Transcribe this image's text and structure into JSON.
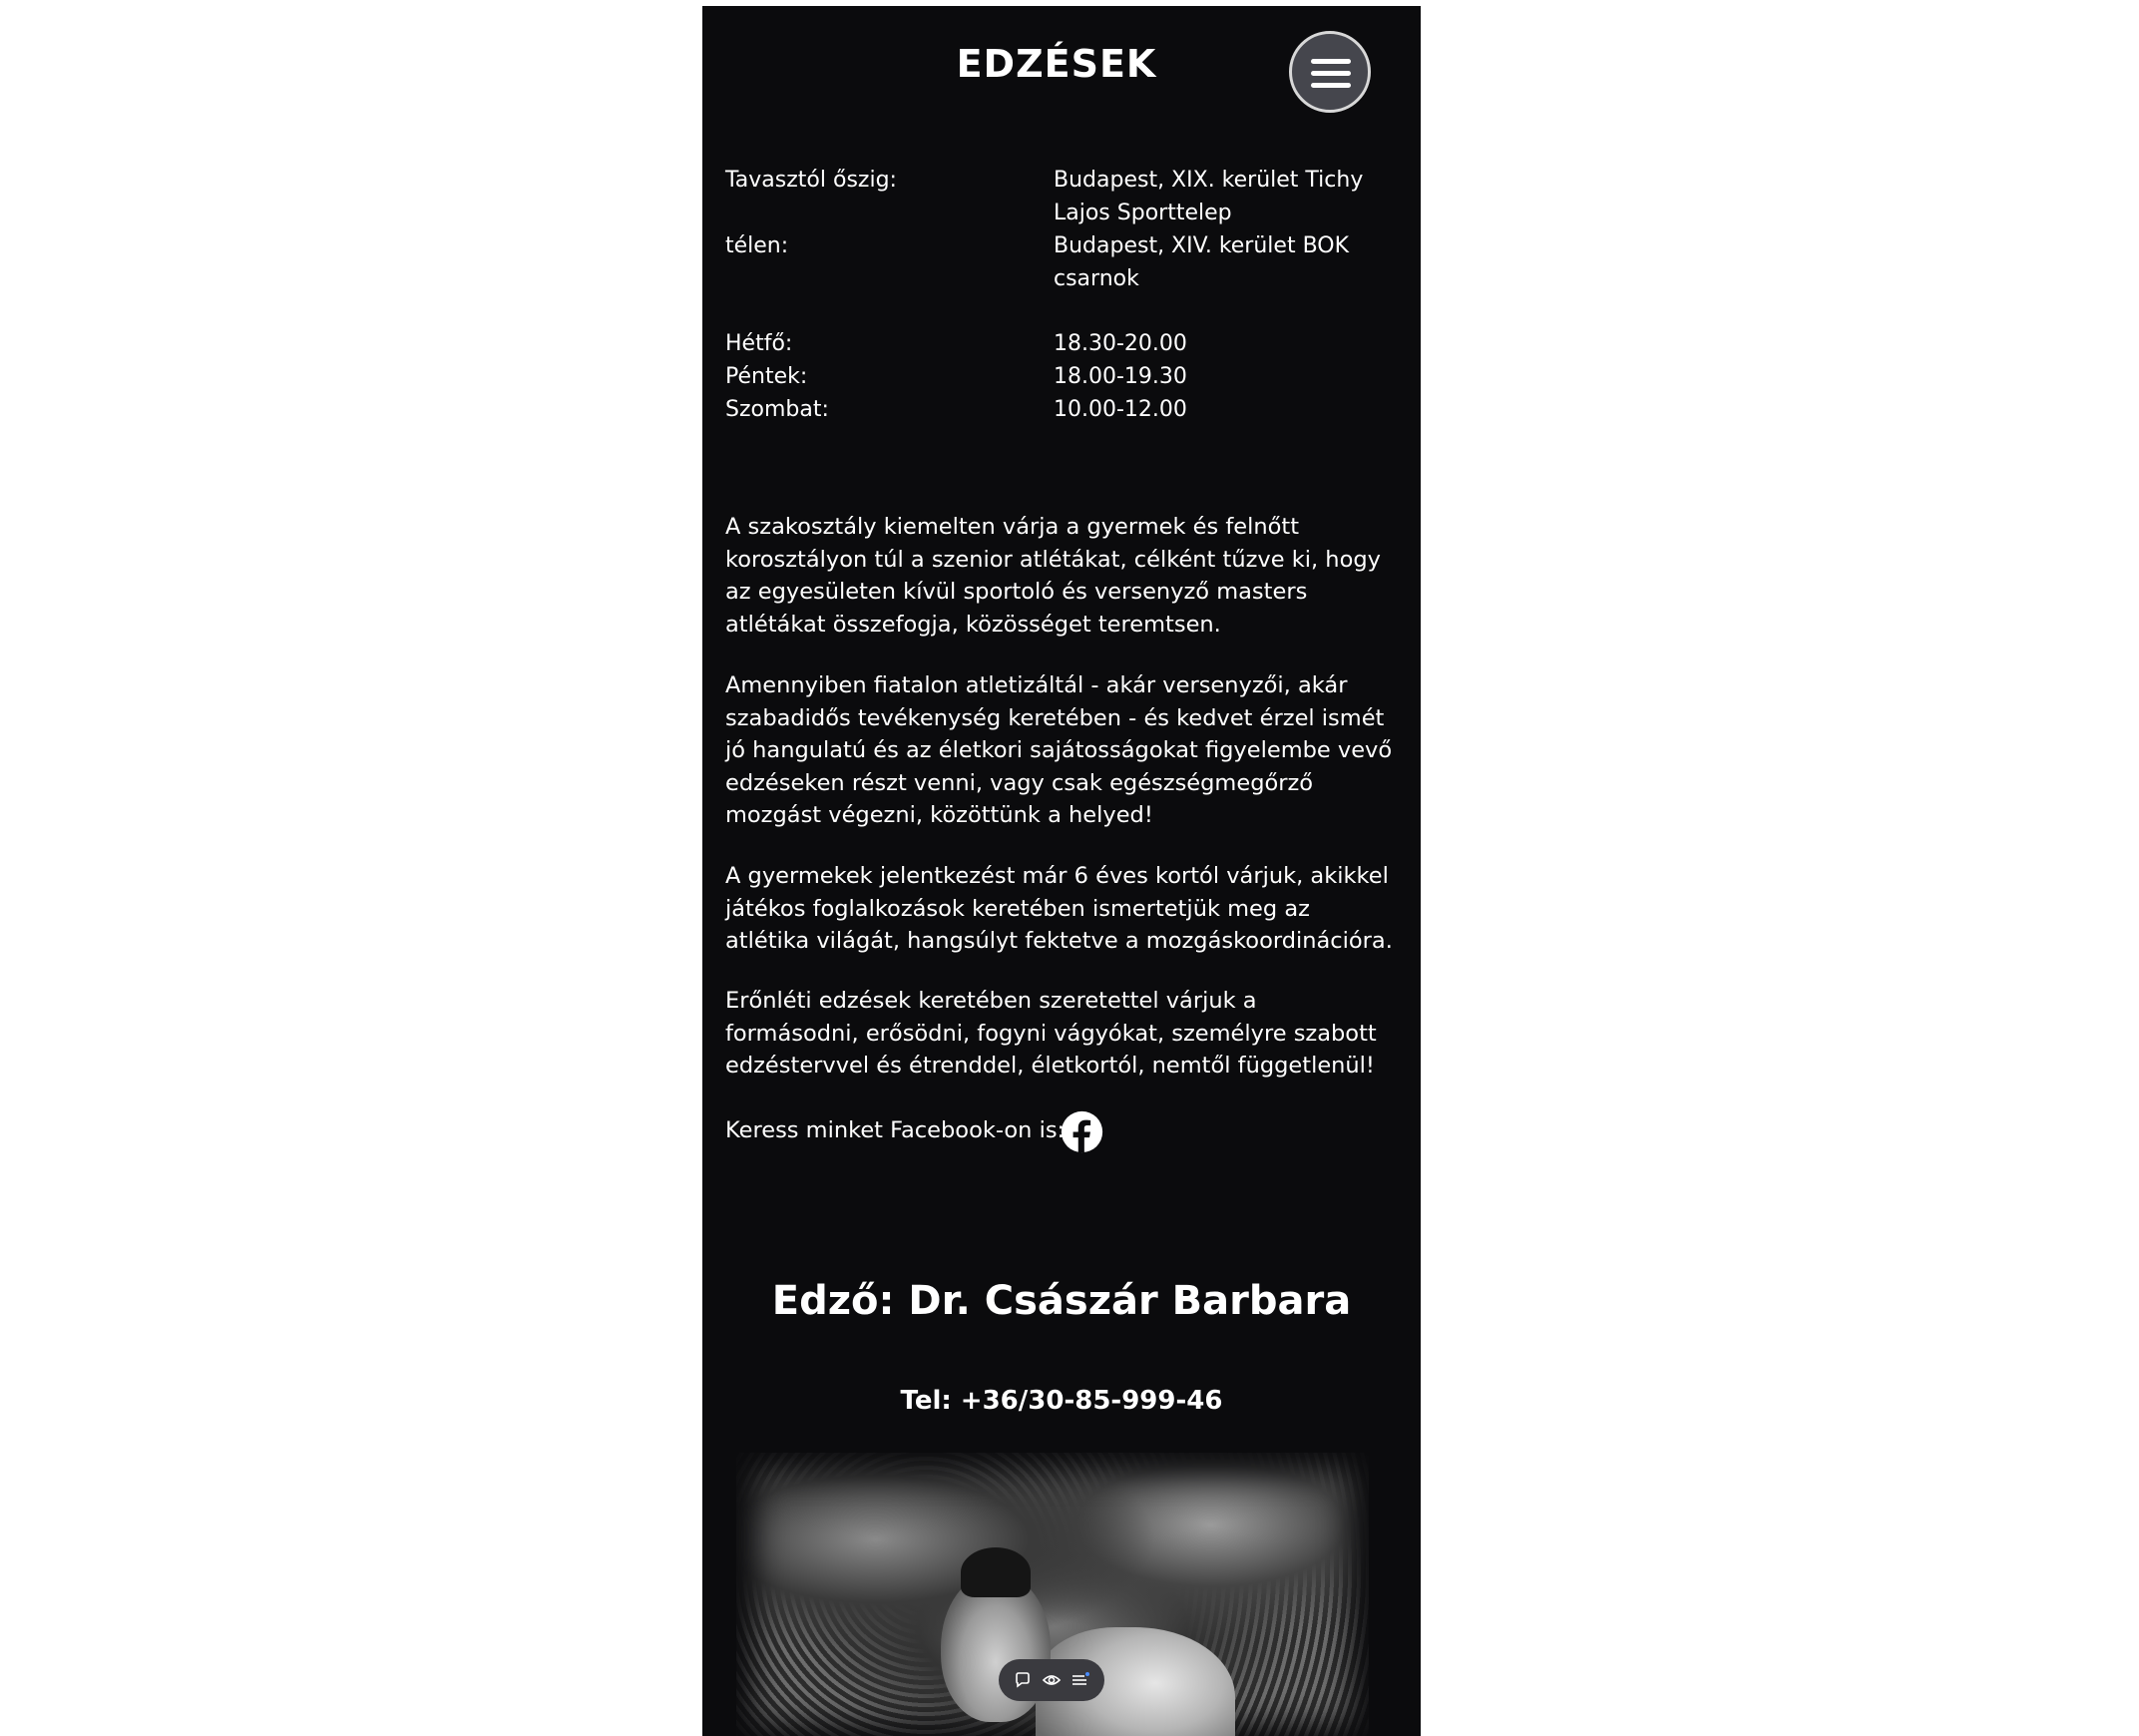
{
  "header": {
    "title": "EDZÉSEK"
  },
  "locations": [
    {
      "label": "Tavasztól őszig:",
      "value": "Budapest, XIX. kerület Tichy Lajos Sporttelep"
    },
    {
      "label": "télen:",
      "value": "Budapest, XIV. kerület BOK csarnok"
    }
  ],
  "schedule": [
    {
      "day": "Hétfő:",
      "time": "18.30-20.00"
    },
    {
      "day": "Péntek:",
      "time": "18.00-19.30"
    },
    {
      "day": "Szombat:",
      "time": "10.00-12.00"
    }
  ],
  "paragraphs": [
    "A szakosztály kiemelten várja a gyermek és felnőtt korosztályon túl a szenior atlétákat, célként tűzve ki, hogy az egyesületen kívül sportoló és versenyző masters atlétákat összefogja, közösséget teremtsen.",
    "Amennyiben fiatalon atletizáltál - akár versenyzői, akár szabadidős tevékenység keretében - és kedvet érzel ismét jó hangulatú és az életkori sajátosságokat figyelembe vevő edzéseken részt venni, vagy csak egészségmegőrző mozgást végezni, közöttünk a helyed!",
    "A gyermekek jelentkezést már 6 éves kortól várjuk, akikkel játékos foglalkozások keretében ismertetjük meg az atlétika világát, hangsúlyt fektetve a mozgáskoordinációra.",
    "Erőnléti edzések keretében szeretettel várjuk a formásodni, erősödni, fogyni vágyókat, személyre szabott edzéstervvel és étrenddel, életkortól, nemtől függetlenül!"
  ],
  "facebook": {
    "text": "Keress minket Facebook-on is:",
    "icon": "facebook-icon"
  },
  "coach": {
    "title": "Edző: Dr. Császár Barbara",
    "phone": "Tel: +36/30-85-999-46"
  },
  "toolbar": {
    "icons": [
      "comment-icon",
      "eye-icon",
      "list-icon"
    ]
  },
  "colors": {
    "background": "#0b0b0d",
    "text": "#ffffff",
    "menu_button": "#45464d"
  }
}
